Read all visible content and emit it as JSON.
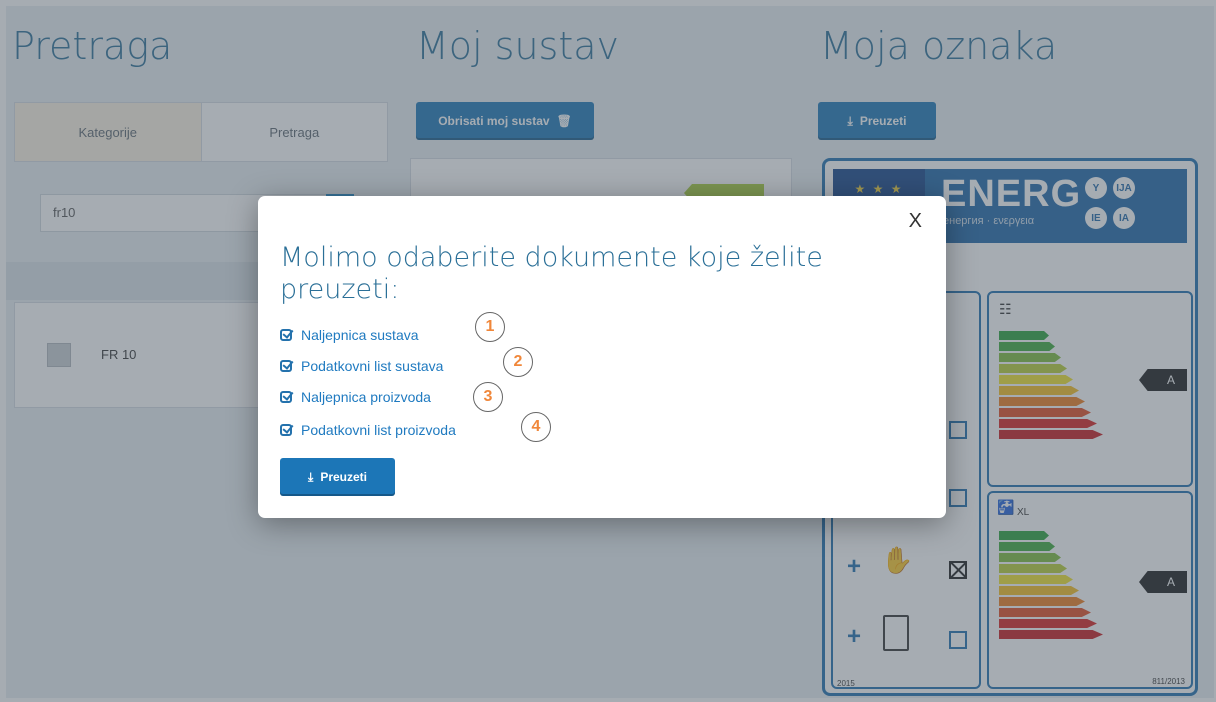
{
  "columns": {
    "search_title": "Pretraga",
    "system_title": "Moj sustav",
    "label_title": "Moja oznaka"
  },
  "search": {
    "tabs": [
      {
        "label": "Kategorije"
      },
      {
        "label": "Pretraga"
      }
    ],
    "query": "fr10",
    "results": [
      {
        "label": "FR 10"
      }
    ]
  },
  "system": {
    "clear_button": "Obrisati moj sustav"
  },
  "label": {
    "download_button": "Preuzeti",
    "energ_text": "ENERG",
    "energ_subtitle": "енергия · ενεργεια",
    "lang_badges": [
      "Y",
      "IJA",
      "IE",
      "IA"
    ],
    "grade_heating": "A",
    "grade_water": "A",
    "tap_size": "XL",
    "year": "2015",
    "regulation": "811/2013"
  },
  "modal": {
    "close_label": "X",
    "title": "Molimo odaberite dokumente koje želite preuzeti:",
    "options": [
      {
        "label": "Naljepnica sustava",
        "number": "1",
        "checked": true
      },
      {
        "label": "Podatkovni list sustava",
        "number": "2",
        "checked": true
      },
      {
        "label": "Naljepnica proizvoda",
        "number": "3",
        "checked": true
      },
      {
        "label": "Podatkovni list proizvoda",
        "number": "4",
        "checked": true
      }
    ],
    "download_button": "Preuzeti"
  }
}
